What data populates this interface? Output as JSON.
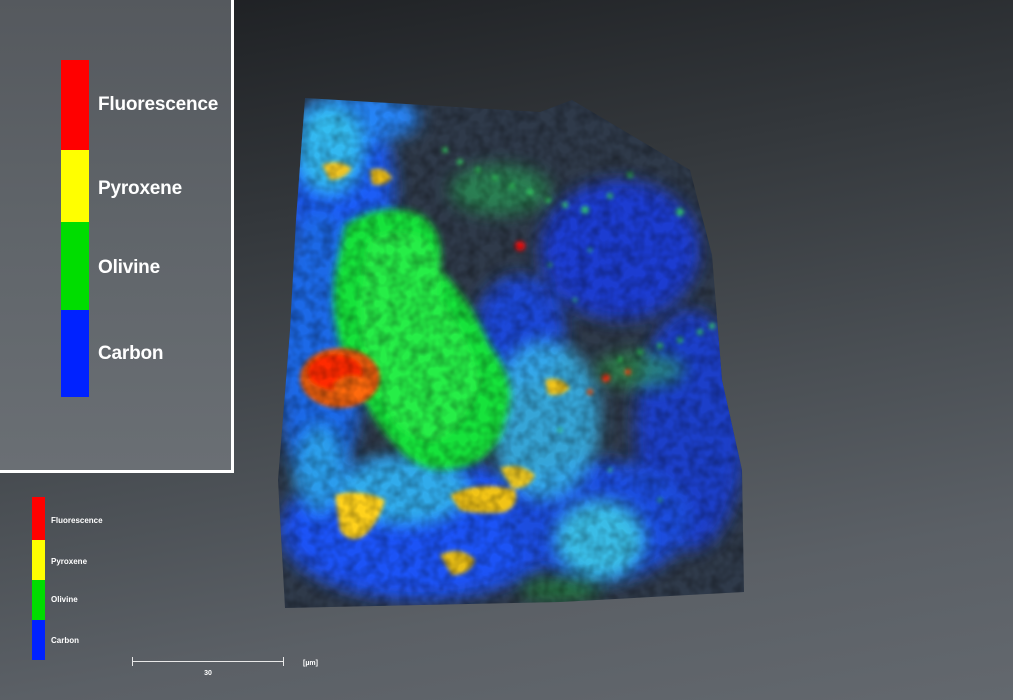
{
  "legend": {
    "items": [
      {
        "label": "Fluorescence",
        "color": "#ff0000"
      },
      {
        "label": "Pyroxene",
        "color": "#ffff00"
      },
      {
        "label": "Olivine",
        "color": "#00dd00"
      },
      {
        "label": "Carbon",
        "color": "#0022ff"
      }
    ]
  },
  "mini_legend": {
    "items": [
      {
        "label": "Fluorescence",
        "color": "#ff0000"
      },
      {
        "label": "Pyroxene",
        "color": "#ffff00"
      },
      {
        "label": "Olivine",
        "color": "#00dd00"
      },
      {
        "label": "Carbon",
        "color": "#0022ff"
      }
    ]
  },
  "scale_bar": {
    "value": "30",
    "unit": "[µm]"
  },
  "colors": {
    "background_top": "#1c1e21",
    "background_bottom": "#63686e",
    "panel_border": "#ffffff"
  }
}
